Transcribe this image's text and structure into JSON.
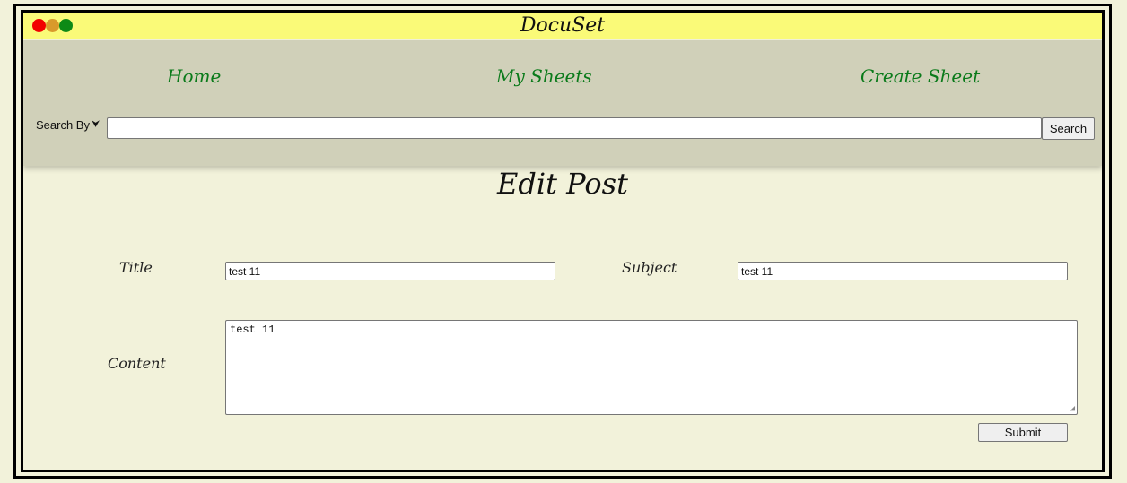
{
  "window": {
    "title": "DocuSet",
    "controls": {
      "close_color": "#f20000",
      "minimize_color": "#d99a2b",
      "maximize_color": "#0d8a16"
    }
  },
  "nav": {
    "items": [
      {
        "label": "Home"
      },
      {
        "label": "My Sheets"
      },
      {
        "label": "Create Sheet"
      }
    ]
  },
  "search": {
    "by_label": "Search By",
    "by_icon": "chevron-down-icon",
    "value": "",
    "button_label": "Search"
  },
  "page": {
    "heading": "Edit Post"
  },
  "form": {
    "title_label": "Title",
    "title_value": "test 11",
    "subject_label": "Subject",
    "subject_value": "test 11",
    "content_label": "Content",
    "content_value": "test 11",
    "submit_label": "Submit"
  },
  "colors": {
    "titlebar": "#fafa78",
    "navbar": "#d0d0b9",
    "page_bg": "#f2f2da",
    "nav_link": "#0a7a1a"
  }
}
